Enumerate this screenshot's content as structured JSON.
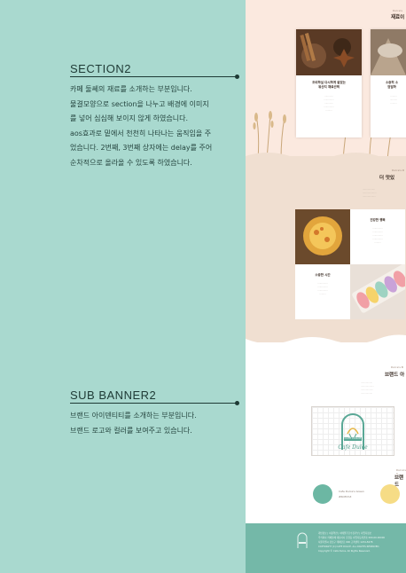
{
  "sections": [
    {
      "title": "SECTION2",
      "lines": [
        "카페 둘쎄의 재료를 소개하는 부분입니다.",
        "물결모양으로 section을 나누고 배경에 이미지",
        "를 넣어 심심해 보이지 않게 하였습니다.",
        "aos효과로 밑에서 천천히 나타나는 움직임을 주",
        "었습니다. 2번째, 3번째 상자에는 delay를 주어",
        "순차적으로 올라올 수 있도록 하였습니다."
      ]
    },
    {
      "title": "SUB BANNER2",
      "lines": [
        "브랜드 아이덴티티를 소개하는 부분입니다.",
        "브랜드 로고와 컬러를 보여주고 있습니다."
      ]
    }
  ],
  "preview": {
    "s2_label": "Dulce's Story",
    "s2_heading": "재료이",
    "card1_title_1": "조리하실 다시하게 갈았는",
    "card1_title_2": "유산지 재료선택",
    "card2_title_1": "소중히 소",
    "card2_title_2": "엄밀하",
    "s3_label": "Dulce's D",
    "s3_heading": "더 맛있",
    "card3_title": "건강한 행복",
    "card4_title": "소중한 시간",
    "brand_label": "Dulce's B",
    "brand_heading": "브랜드 아",
    "logo_text": "Cafe Dulce",
    "logo_small": "CAFE DULCE",
    "color_label": "Dulce's C",
    "color_heading": "브랜드",
    "swatch1_name": "Cafe Dulce's Green",
    "swatch1_hex": "#6CB7A3",
    "footer_lines": [
      "개인정보  |  이용약관  |  이메일무단수집거부  |  사업자정보",
      "주식회사 카페둘쎄  대표이사 홍길동  사업자등록번호 000-00-00000",
      "서울특별시 강남구 테헤란로 000  고객센터 1234-5678",
      "COPYRIGHT (C) CAFE DULCE. ALL RIGHTS RESERVED.",
      "Copyright © Cafe Dulce. All Rights Reserved."
    ]
  },
  "colors": {
    "background": "#a9d9cf",
    "brand_green": "#6CB7A3",
    "brand_yellow": "#f6dc86",
    "footer": "#74b8a8"
  }
}
